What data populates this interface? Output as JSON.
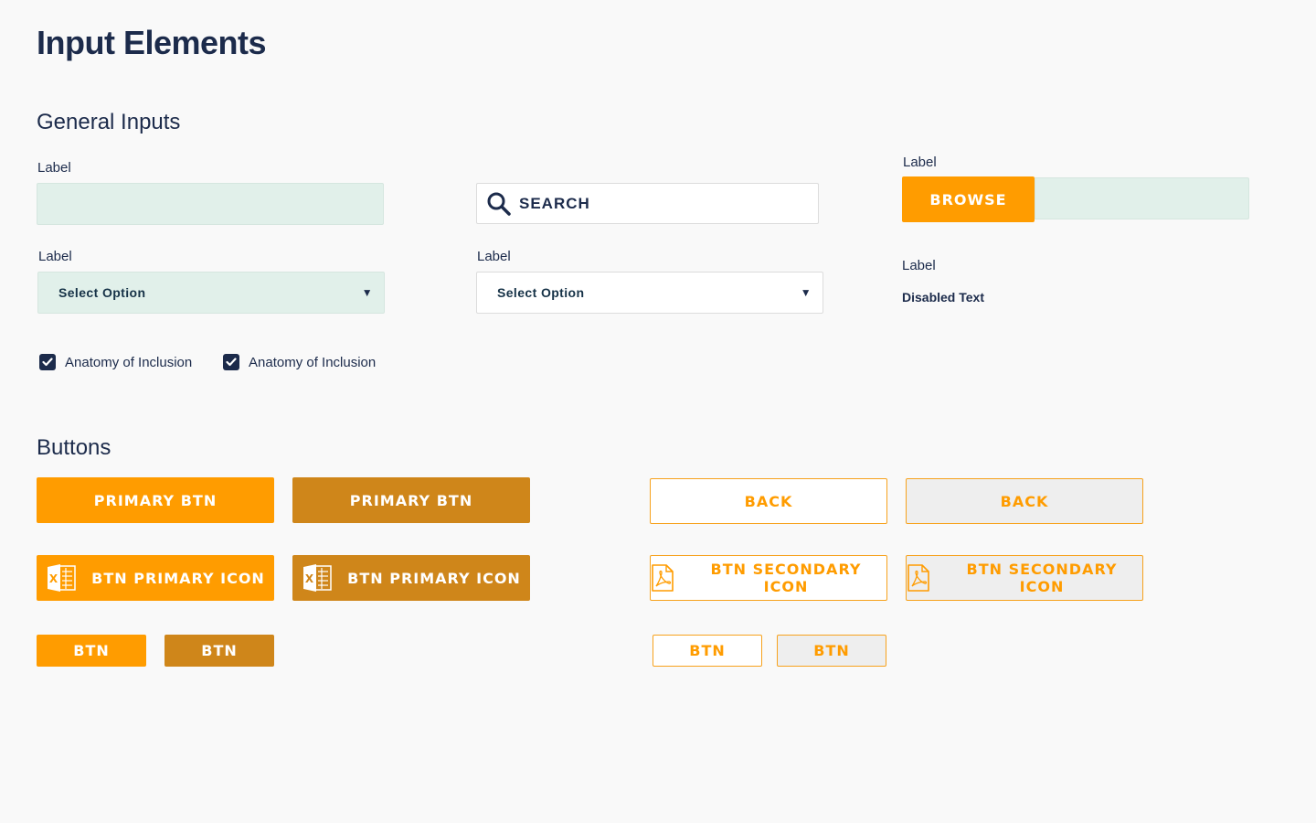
{
  "page": {
    "title": "Input Elements"
  },
  "general_inputs": {
    "section_title": "General Inputs",
    "text_field": {
      "label": "Label",
      "value": ""
    },
    "search": {
      "placeholder": "SEARCH"
    },
    "browse": {
      "label": "Label",
      "button_label": "BROWSE",
      "value": ""
    },
    "select_mint": {
      "label": "Label",
      "selected": "Select Option"
    },
    "select_white": {
      "label": "Label",
      "selected": "Select Option"
    },
    "disabled": {
      "label": "Label",
      "text": "Disabled Text"
    },
    "checkboxes": [
      {
        "label": "Anatomy of Inclusion",
        "checked": true
      },
      {
        "label": "Anatomy of Inclusion",
        "checked": true
      }
    ]
  },
  "buttons": {
    "section_title": "Buttons",
    "primary_label": "PRIMARY BTN",
    "primary_icon_label": "BTN PRIMARY ICON",
    "back_label": "BACK",
    "secondary_icon_label": "BTN SECONDARY ICON",
    "small_label": "BTN"
  },
  "colors": {
    "primary": "#ff9c00",
    "primary_dark": "#cf861a",
    "navy": "#1c2b4b",
    "mint": "#e1f0ea",
    "grey": "#eeeeee"
  },
  "icons": {
    "search": "search-icon",
    "excel": "excel-icon",
    "pdf": "pdf-icon",
    "checkmark": "checkmark-icon",
    "caret": "caret-down-icon"
  }
}
